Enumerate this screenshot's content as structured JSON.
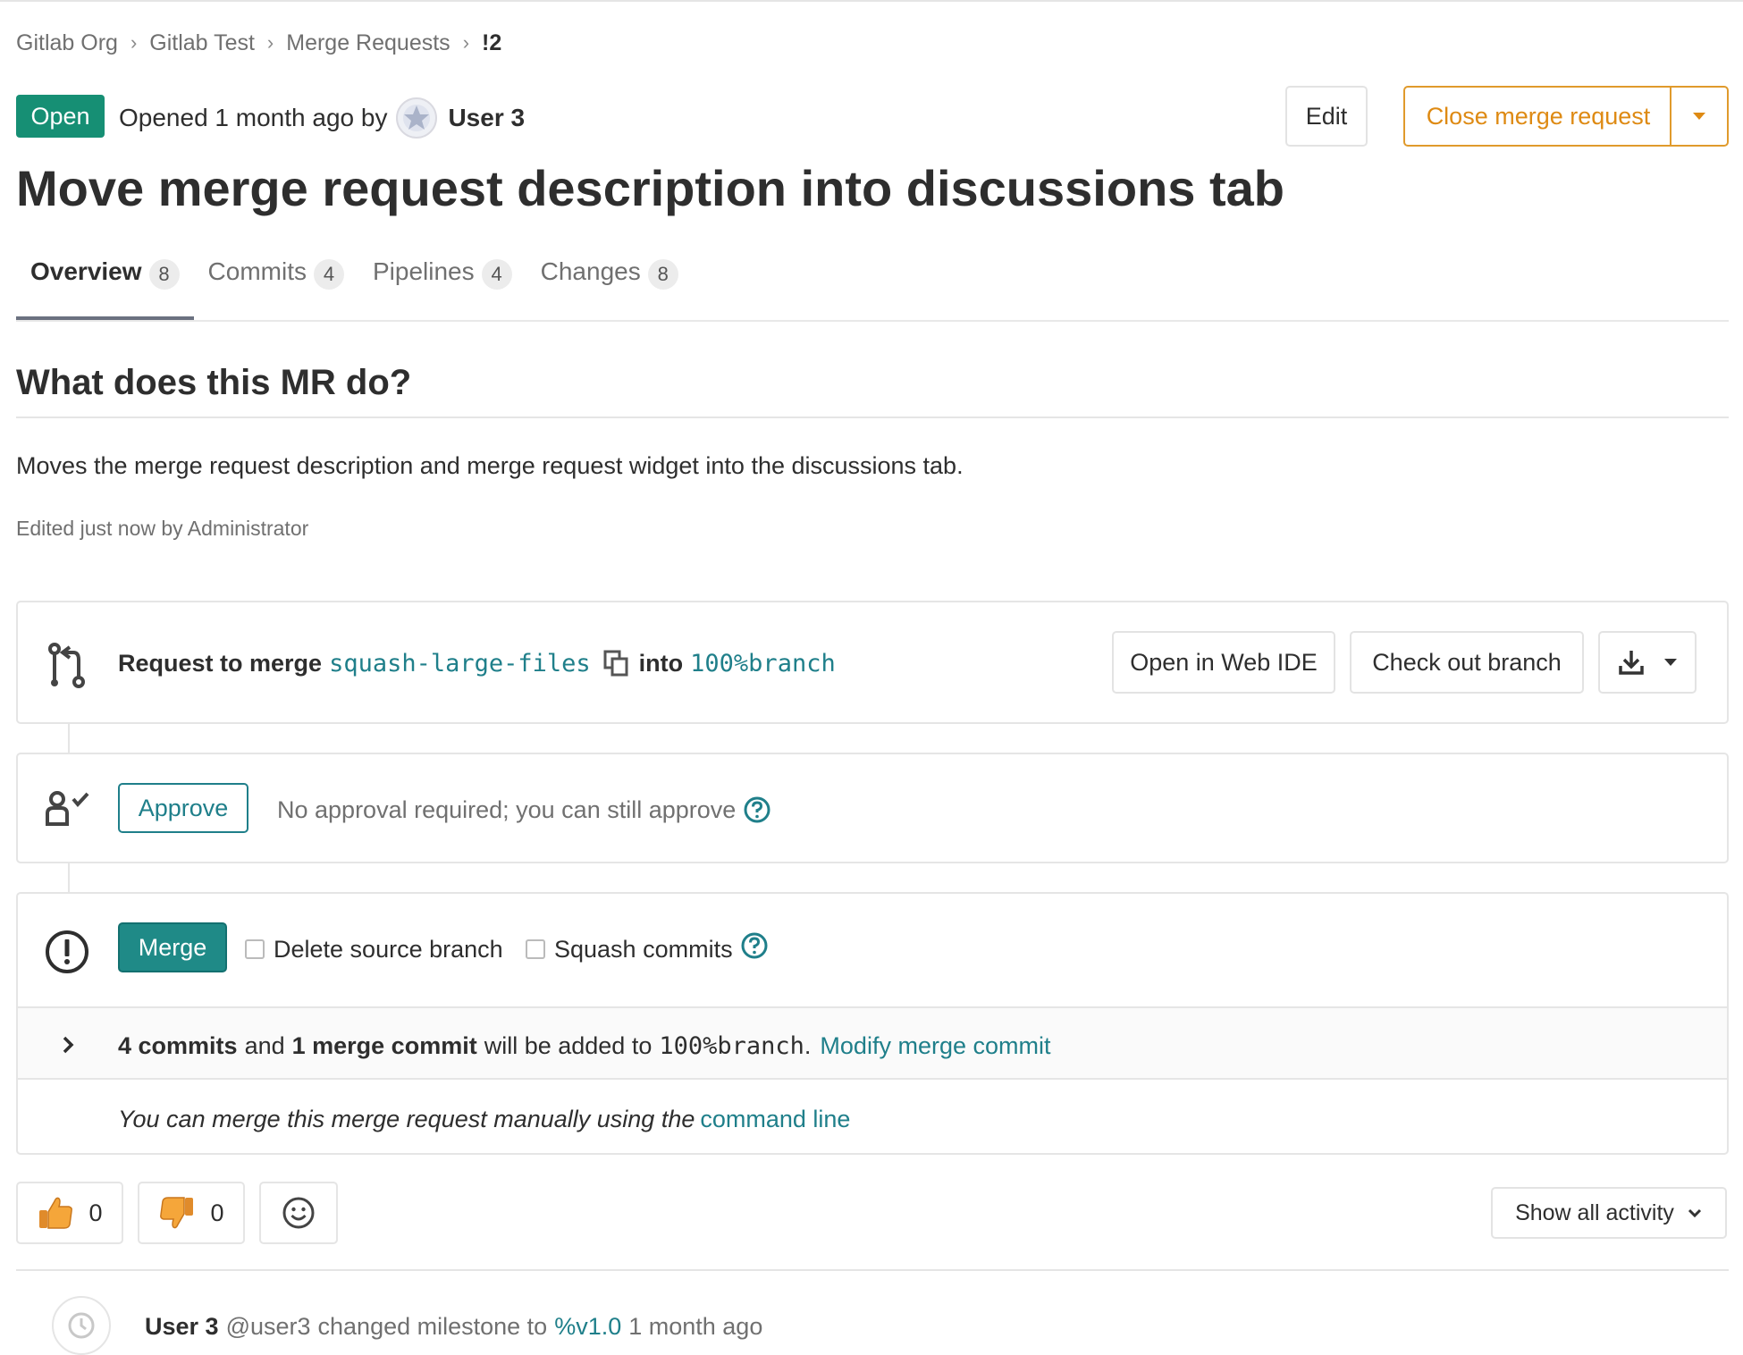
{
  "breadcrumb": [
    "Gitlab Org",
    "Gitlab Test",
    "Merge Requests",
    "!2"
  ],
  "status_badge": "Open",
  "opened_text": "Opened 1 month ago by",
  "author": "User 3",
  "buttons": {
    "edit": "Edit",
    "close": "Close merge request",
    "open_web_ide": "Open in Web IDE",
    "check_out_branch": "Check out branch",
    "approve": "Approve",
    "merge": "Merge",
    "show_activity": "Show all activity"
  },
  "title": "Move merge request description into discussions tab",
  "tabs": [
    {
      "label": "Overview",
      "count": "8"
    },
    {
      "label": "Commits",
      "count": "4"
    },
    {
      "label": "Pipelines",
      "count": "4"
    },
    {
      "label": "Changes",
      "count": "8"
    }
  ],
  "description": {
    "heading": "What does this MR do?",
    "body": "Moves the merge request description and merge request widget into the discussions tab.",
    "edited": "Edited just now by Administrator"
  },
  "merge_widget": {
    "request_to_merge": "Request to merge",
    "source_branch": "squash-large-files",
    "into": "into",
    "target_branch": "100%branch",
    "approval_text": "No approval required; you can still approve",
    "delete_source_label": "Delete source branch",
    "squash_label": "Squash commits",
    "commits_count": "4 commits",
    "and": "and",
    "merge_commit_count": "1 merge commit",
    "will_be_added": "will be added to",
    "target_branch_mono": "100%branch",
    "period": ".",
    "modify_link": "Modify merge commit",
    "manual_text": "You can merge this merge request manually using the",
    "command_line_link": "command line"
  },
  "awards": {
    "thumbsup": "0",
    "thumbsdown": "0"
  },
  "activity": {
    "user": "User 3",
    "handle": "@user3",
    "action": "changed milestone to",
    "milestone": "%v1.0",
    "time": "1 month ago"
  },
  "colors": {
    "accent": "#1f7f8a",
    "open_badge": "#168f74",
    "close_orange": "#de8a13"
  },
  "icons": [
    "chevron-right-icon",
    "avatar-icon",
    "caret-down-icon",
    "merge-request-icon",
    "copy-icon",
    "download-icon",
    "approval-user-icon",
    "help-circle-icon",
    "warning-circle-icon",
    "thumbsup-icon",
    "thumbsdown-icon",
    "smiley-icon",
    "clock-icon"
  ]
}
